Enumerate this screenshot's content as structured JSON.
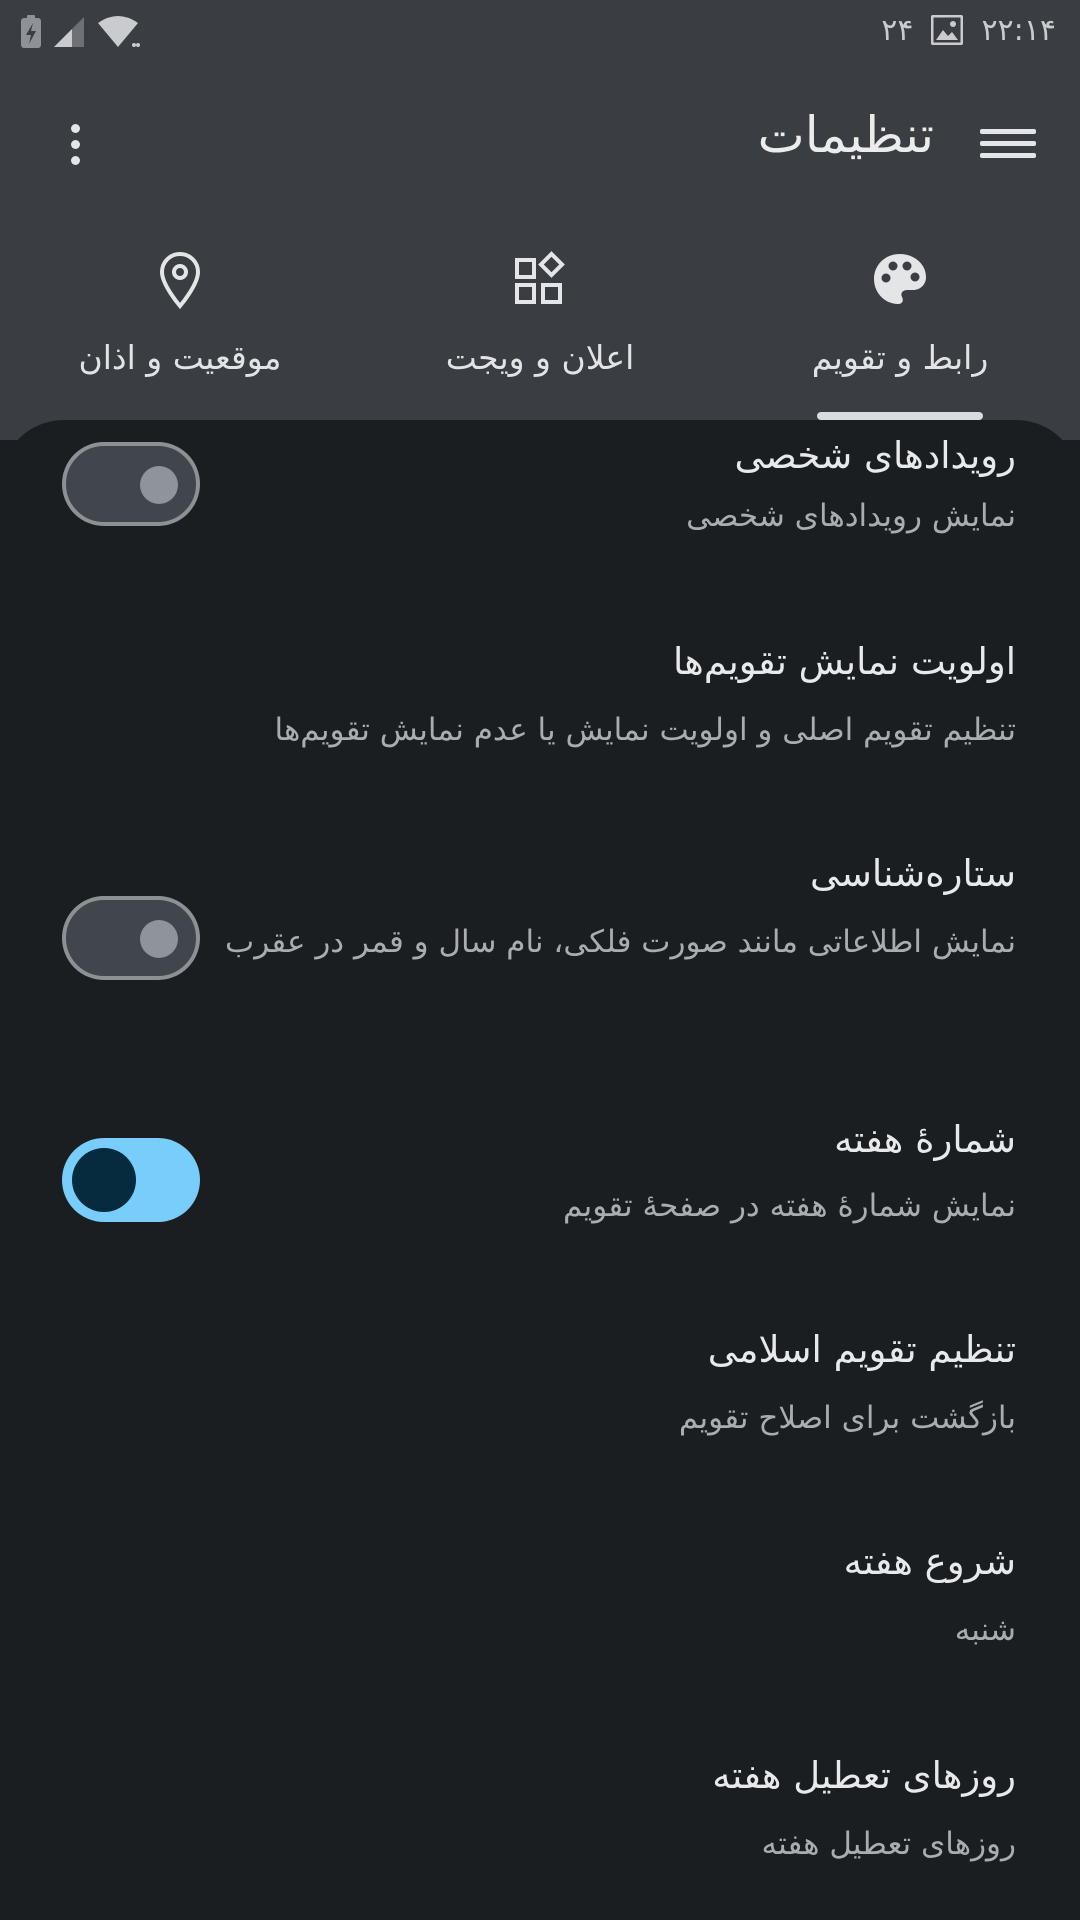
{
  "status_bar": {
    "time": "۲۲:۱۴",
    "date": "۲۴"
  },
  "app_bar": {
    "title": "تنظیمات"
  },
  "tabs": [
    {
      "label": "رابط و تقویم",
      "icon": "palette-icon",
      "selected": true
    },
    {
      "label": "اعلان و ویجت",
      "icon": "widgets-icon",
      "selected": false
    },
    {
      "label": "موقعیت و اذان",
      "icon": "location-pin-icon",
      "selected": false
    }
  ],
  "settings": [
    {
      "title": "رویدادهای شخصی",
      "subtitle": "نمایش رویدادهای شخصی",
      "switch": "off"
    },
    {
      "title": "اولویت نمایش تقویم‌ها",
      "subtitle": "تنظیم تقویم اصلی و اولویت نمایش یا عدم نمایش تقویم‌ها"
    },
    {
      "title": "ستاره‌شناسی",
      "subtitle": "نمایش اطلاعاتی مانند صورت فلکی، نام سال و قمر در عقرب",
      "switch": "off"
    },
    {
      "title": "شمارهٔ هفته",
      "subtitle": "نمایش شمارهٔ هفته در صفحهٔ تقویم",
      "switch": "on"
    },
    {
      "title": "تنظیم تقویم اسلامی",
      "subtitle": "بازگشت برای اصلاح تقویم"
    },
    {
      "title": "شروع هفته",
      "subtitle": "شنبه"
    },
    {
      "title": "روزهای تعطیل هفته",
      "subtitle": "روزهای تعطیل هفته"
    }
  ],
  "colors": {
    "header_bg": "#3a3d42",
    "content_bg": "#1b1e21",
    "switch_on": "#79cdfa",
    "switch_off": "#41454c"
  }
}
